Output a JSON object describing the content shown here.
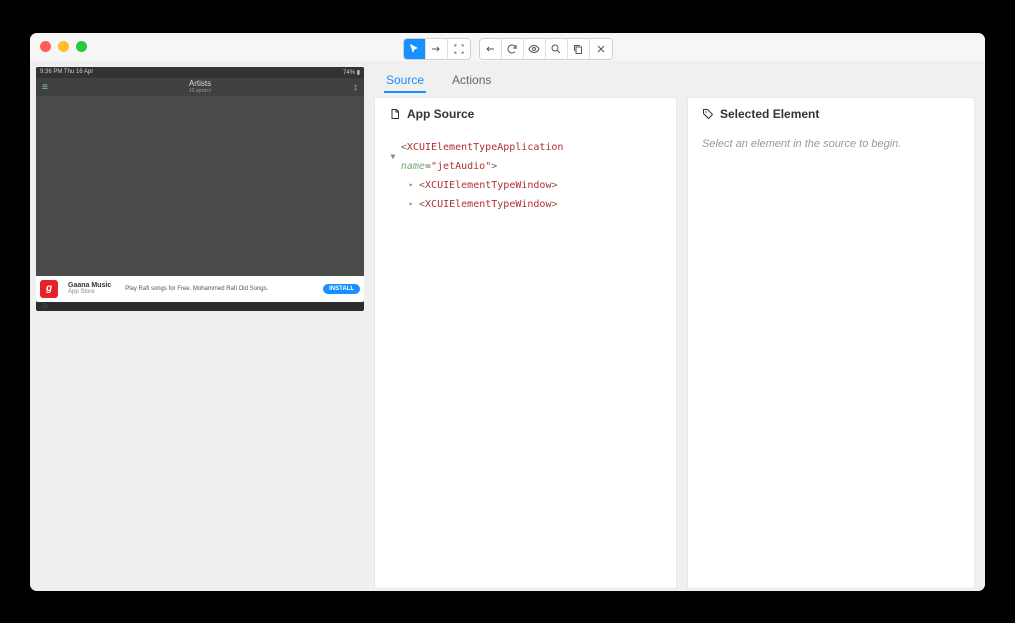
{
  "toolbar": {
    "selectMode": "select",
    "swipeMode": "swipe",
    "tapMode": "tap",
    "back": "back",
    "refresh": "refresh",
    "eye": "toggle",
    "search": "search",
    "copy": "copy",
    "close": "close"
  },
  "tabs": {
    "source": "Source",
    "actions": "Actions"
  },
  "appSourcePanel": {
    "title": "App Source"
  },
  "selectedPanel": {
    "title": "Selected Element",
    "hint": "Select an element in the source to begin."
  },
  "tree": {
    "root": {
      "tag": "XCUIElementTypeApplication",
      "attrName": "name",
      "attrValue": "jetAudio"
    },
    "child1": {
      "tag": "XCUIElementTypeWindow"
    },
    "child2": {
      "tag": "XCUIElementTypeWindow"
    }
  },
  "device": {
    "statusLeft": "9:36 PM   Thu 16 Apr",
    "statusRight": "74% ▮",
    "headerTitle": "Artists",
    "headerSub": "10 артист",
    "ad": {
      "iconLetter": "g",
      "title": "Gaana Music",
      "subtitle": "App Store",
      "desc": "Play Rafi songs for Free. Mohammed Rafi Old Songs.",
      "install": "INSTALL"
    }
  }
}
